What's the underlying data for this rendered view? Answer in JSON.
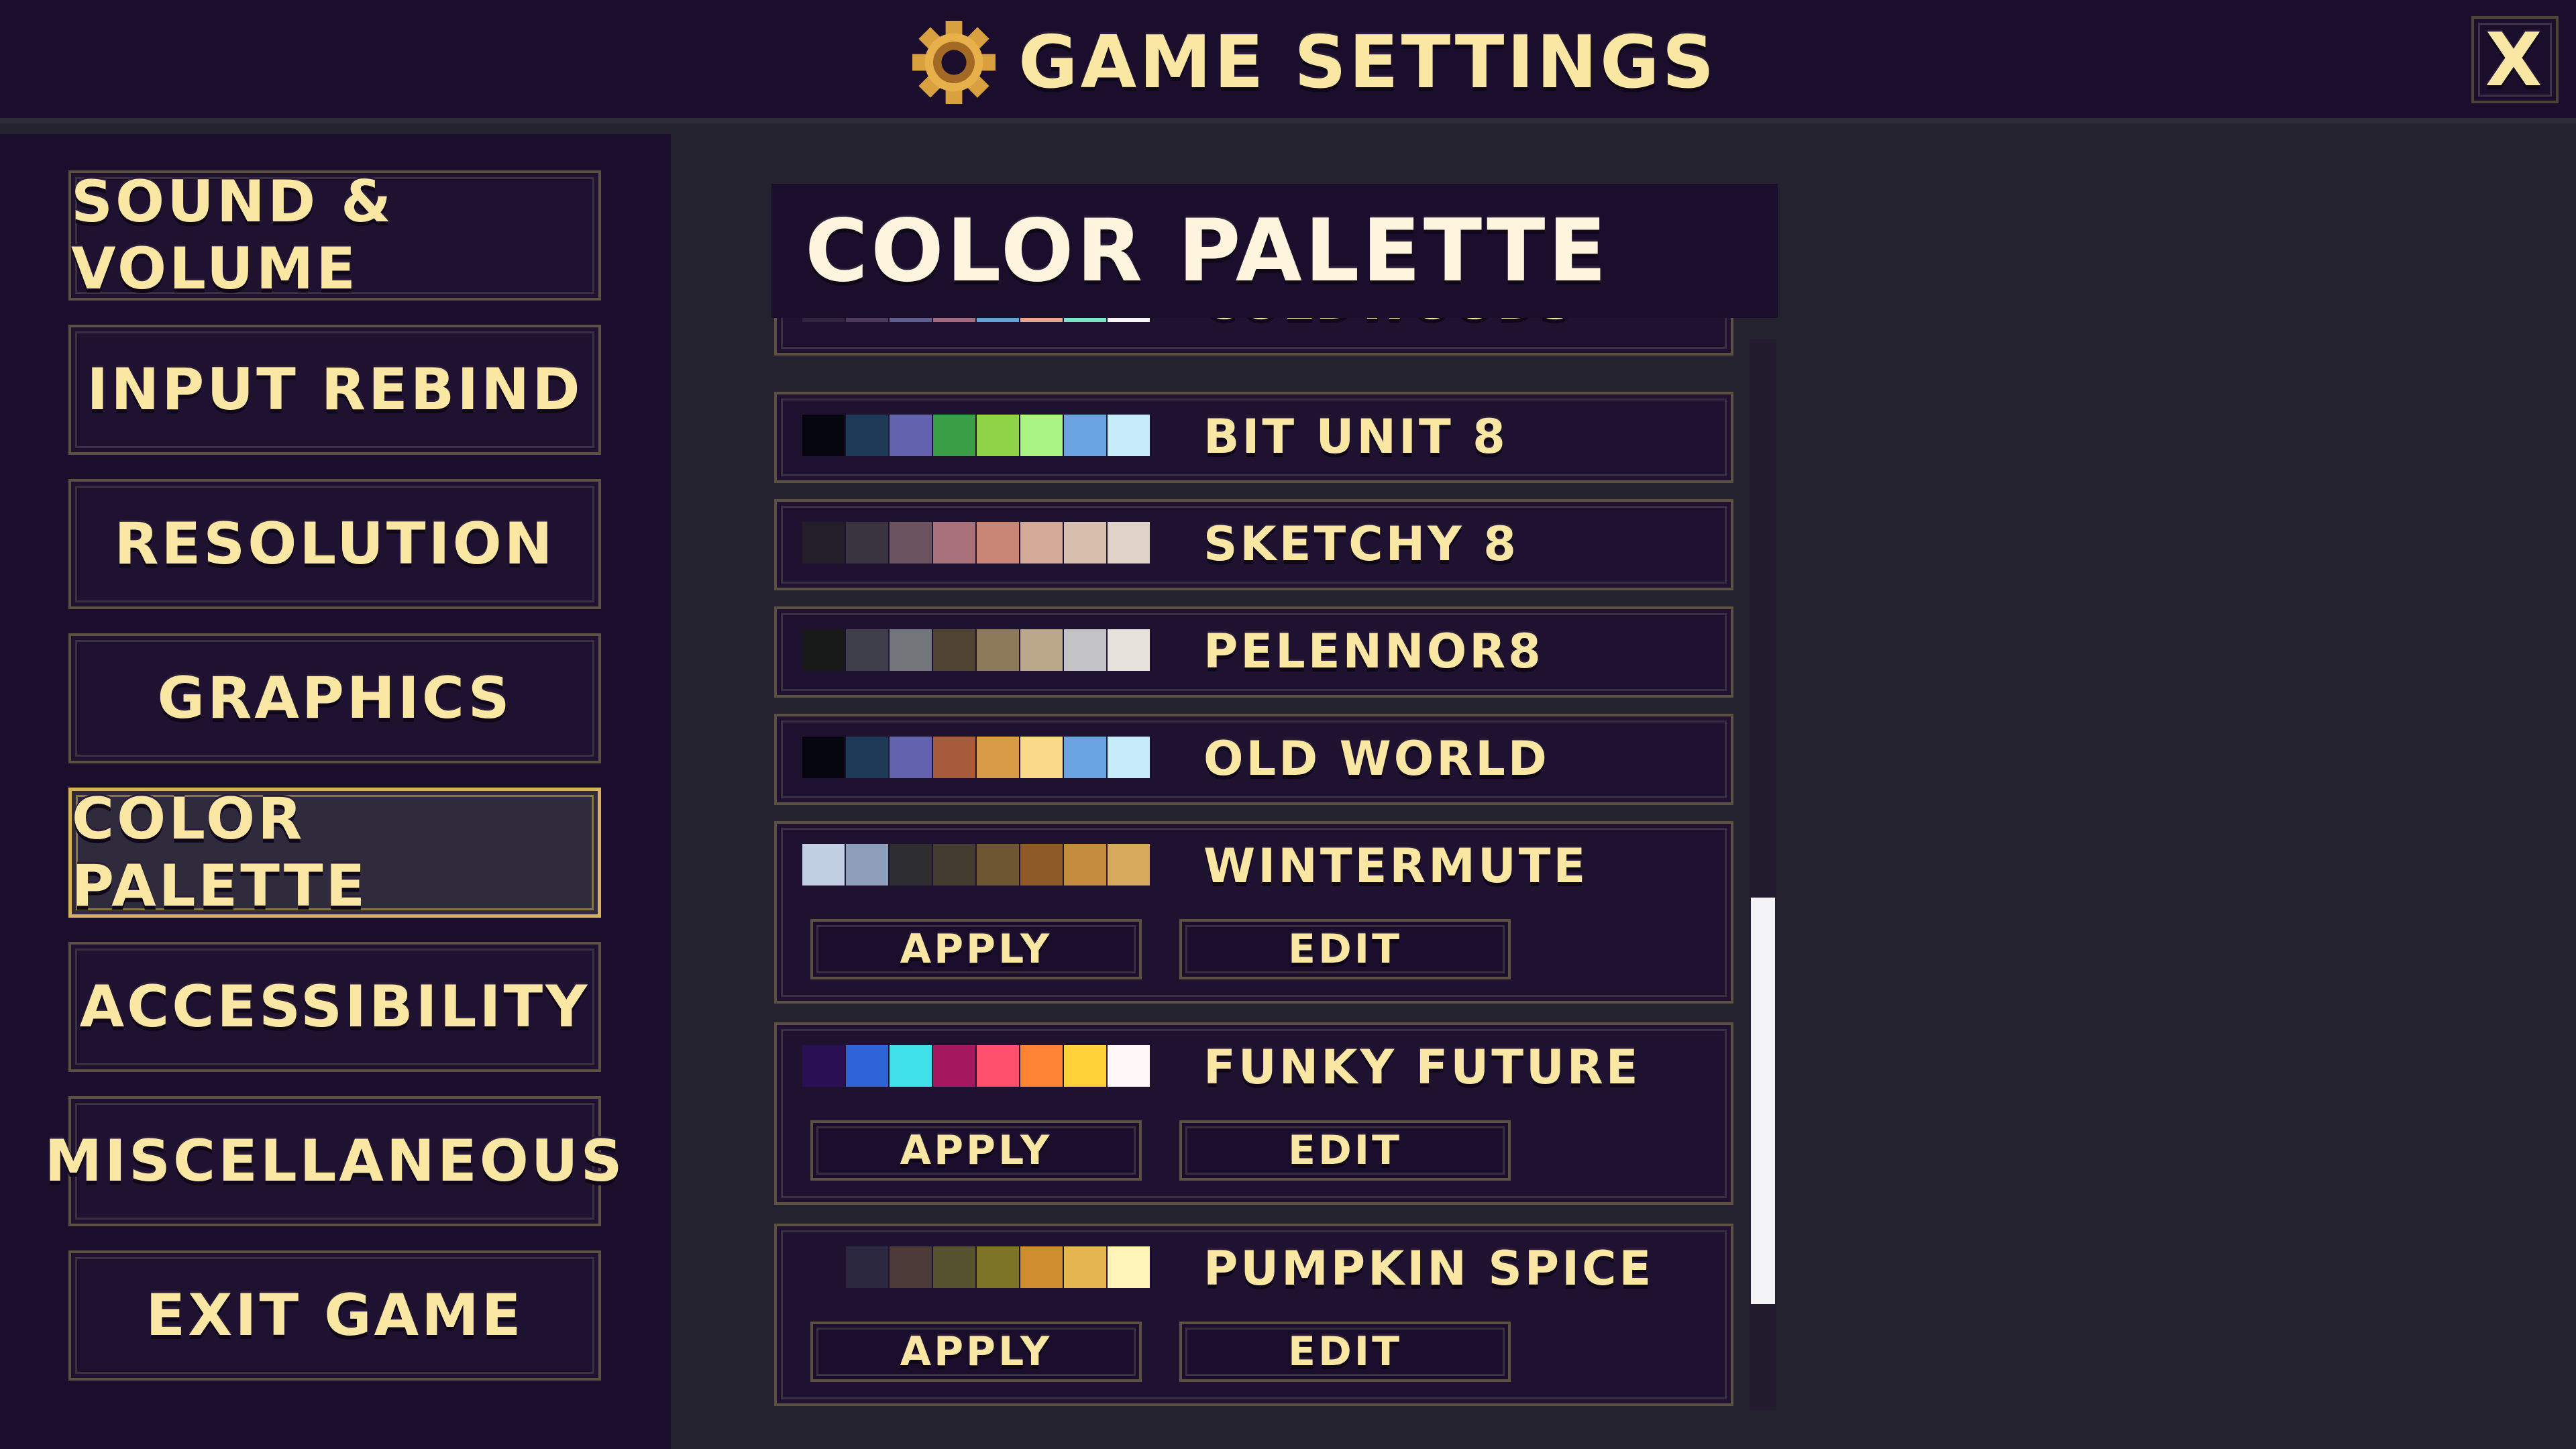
{
  "header": {
    "title": "GAME SETTINGS",
    "icon": "gear-icon",
    "close_label": "X"
  },
  "sidebar": {
    "items": [
      {
        "label": "SOUND & VOLUME",
        "active": false
      },
      {
        "label": "INPUT REBIND",
        "active": false
      },
      {
        "label": "RESOLUTION",
        "active": false
      },
      {
        "label": "GRAPHICS",
        "active": false
      },
      {
        "label": "COLOR PALETTE",
        "active": true
      },
      {
        "label": "ACCESSIBILITY",
        "active": false
      },
      {
        "label": "MISCELLANEOUS",
        "active": false
      },
      {
        "label": "EXIT GAME",
        "active": false
      }
    ]
  },
  "panel": {
    "title": "COLOR PALETTE",
    "apply_label": "APPLY",
    "edit_label": "EDIT",
    "palettes": [
      {
        "name": "COLDWOODS",
        "colors": [
          "#2e2540",
          "#4c3a5c",
          "#5f5f8f",
          "#a56a7e",
          "#5ea6d9",
          "#f0a58a",
          "#7fe3c6",
          "#f5f5f5"
        ],
        "expanded": false
      },
      {
        "name": "BIT UNIT 8",
        "colors": [
          "#05050d",
          "#1e3a57",
          "#6262ad",
          "#3a9e47",
          "#8fd446",
          "#a9f483",
          "#6aa4e0",
          "#c7ecf9"
        ],
        "expanded": false
      },
      {
        "name": "SKETCHY 8",
        "colors": [
          "#221f28",
          "#3a3340",
          "#6b545f",
          "#a9727a",
          "#c98674",
          "#d3ab98",
          "#d6c0ad",
          "#dfd2c7"
        ],
        "expanded": false
      },
      {
        "name": "PELENNOR8",
        "colors": [
          "#181a1a",
          "#3f3f4b",
          "#72767a",
          "#4e4431",
          "#8c7a5a",
          "#bba88a",
          "#c3c2c5",
          "#e8e2dc"
        ],
        "expanded": false
      },
      {
        "name": "OLD WORLD",
        "colors": [
          "#05050d",
          "#1e3a57",
          "#6262ad",
          "#a65b3b",
          "#d89b46",
          "#f9d98a",
          "#6aa4e0",
          "#c7ecf9"
        ],
        "expanded": false
      },
      {
        "name": "WINTERMUTE",
        "colors": [
          "#c1cfe3",
          "#8e9fbb",
          "#2e2e30",
          "#433c30",
          "#6e5632",
          "#8e5a27",
          "#c58c3f",
          "#d6a95c"
        ],
        "expanded": true
      },
      {
        "name": "FUNKY FUTURE",
        "colors": [
          "#2b0f54",
          "#2f64d8",
          "#3fe0ea",
          "#a3185f",
          "#ff4f6d",
          "#ff8335",
          "#ffd23a",
          "#fff7f8"
        ],
        "expanded": true
      },
      {
        "name": "PUMPKIN SPICE",
        "colors": [
          "#1f1130",
          "#2c2840",
          "#4b3a36",
          "#54522f",
          "#7d7427",
          "#cf8d2f",
          "#e4b550",
          "#fff3b8"
        ],
        "expanded": true
      }
    ]
  },
  "scrollbar": {
    "position": 0.84,
    "visible_fraction": 0.38
  }
}
